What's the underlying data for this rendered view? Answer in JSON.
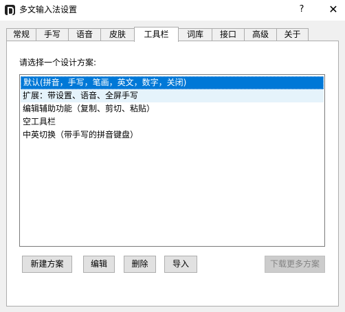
{
  "window": {
    "title": "多文输入法设置",
    "help_label": "?",
    "close_label": "✕"
  },
  "tabs": [
    {
      "label": "常规"
    },
    {
      "label": "手写"
    },
    {
      "label": "语音"
    },
    {
      "label": "皮肤"
    },
    {
      "label": "工具栏",
      "active": true
    },
    {
      "label": "词库"
    },
    {
      "label": "接口"
    },
    {
      "label": "高级"
    },
    {
      "label": "关于"
    }
  ],
  "toolbar_page": {
    "prompt": "请选择一个设计方案:",
    "schemes": [
      {
        "label": "默认(拼音，手写，笔画，英文，数字，关闭)",
        "state": "selected"
      },
      {
        "label": "扩展：带设置、语音、全屏手写",
        "state": "hover"
      },
      {
        "label": "编辑辅助功能（复制、剪切、粘贴）",
        "state": "normal"
      },
      {
        "label": "空工具栏",
        "state": "normal"
      },
      {
        "label": "中英切换（带手写的拼音键盘）",
        "state": "normal"
      }
    ],
    "buttons": {
      "new_scheme": "新建方案",
      "edit": "编辑",
      "delete": "删除",
      "import": "导入",
      "download_more": "下载更多方案"
    }
  },
  "colors": {
    "selection": "#0078d7",
    "hover": "#e5f3fb",
    "disabled_text": "#838383"
  }
}
